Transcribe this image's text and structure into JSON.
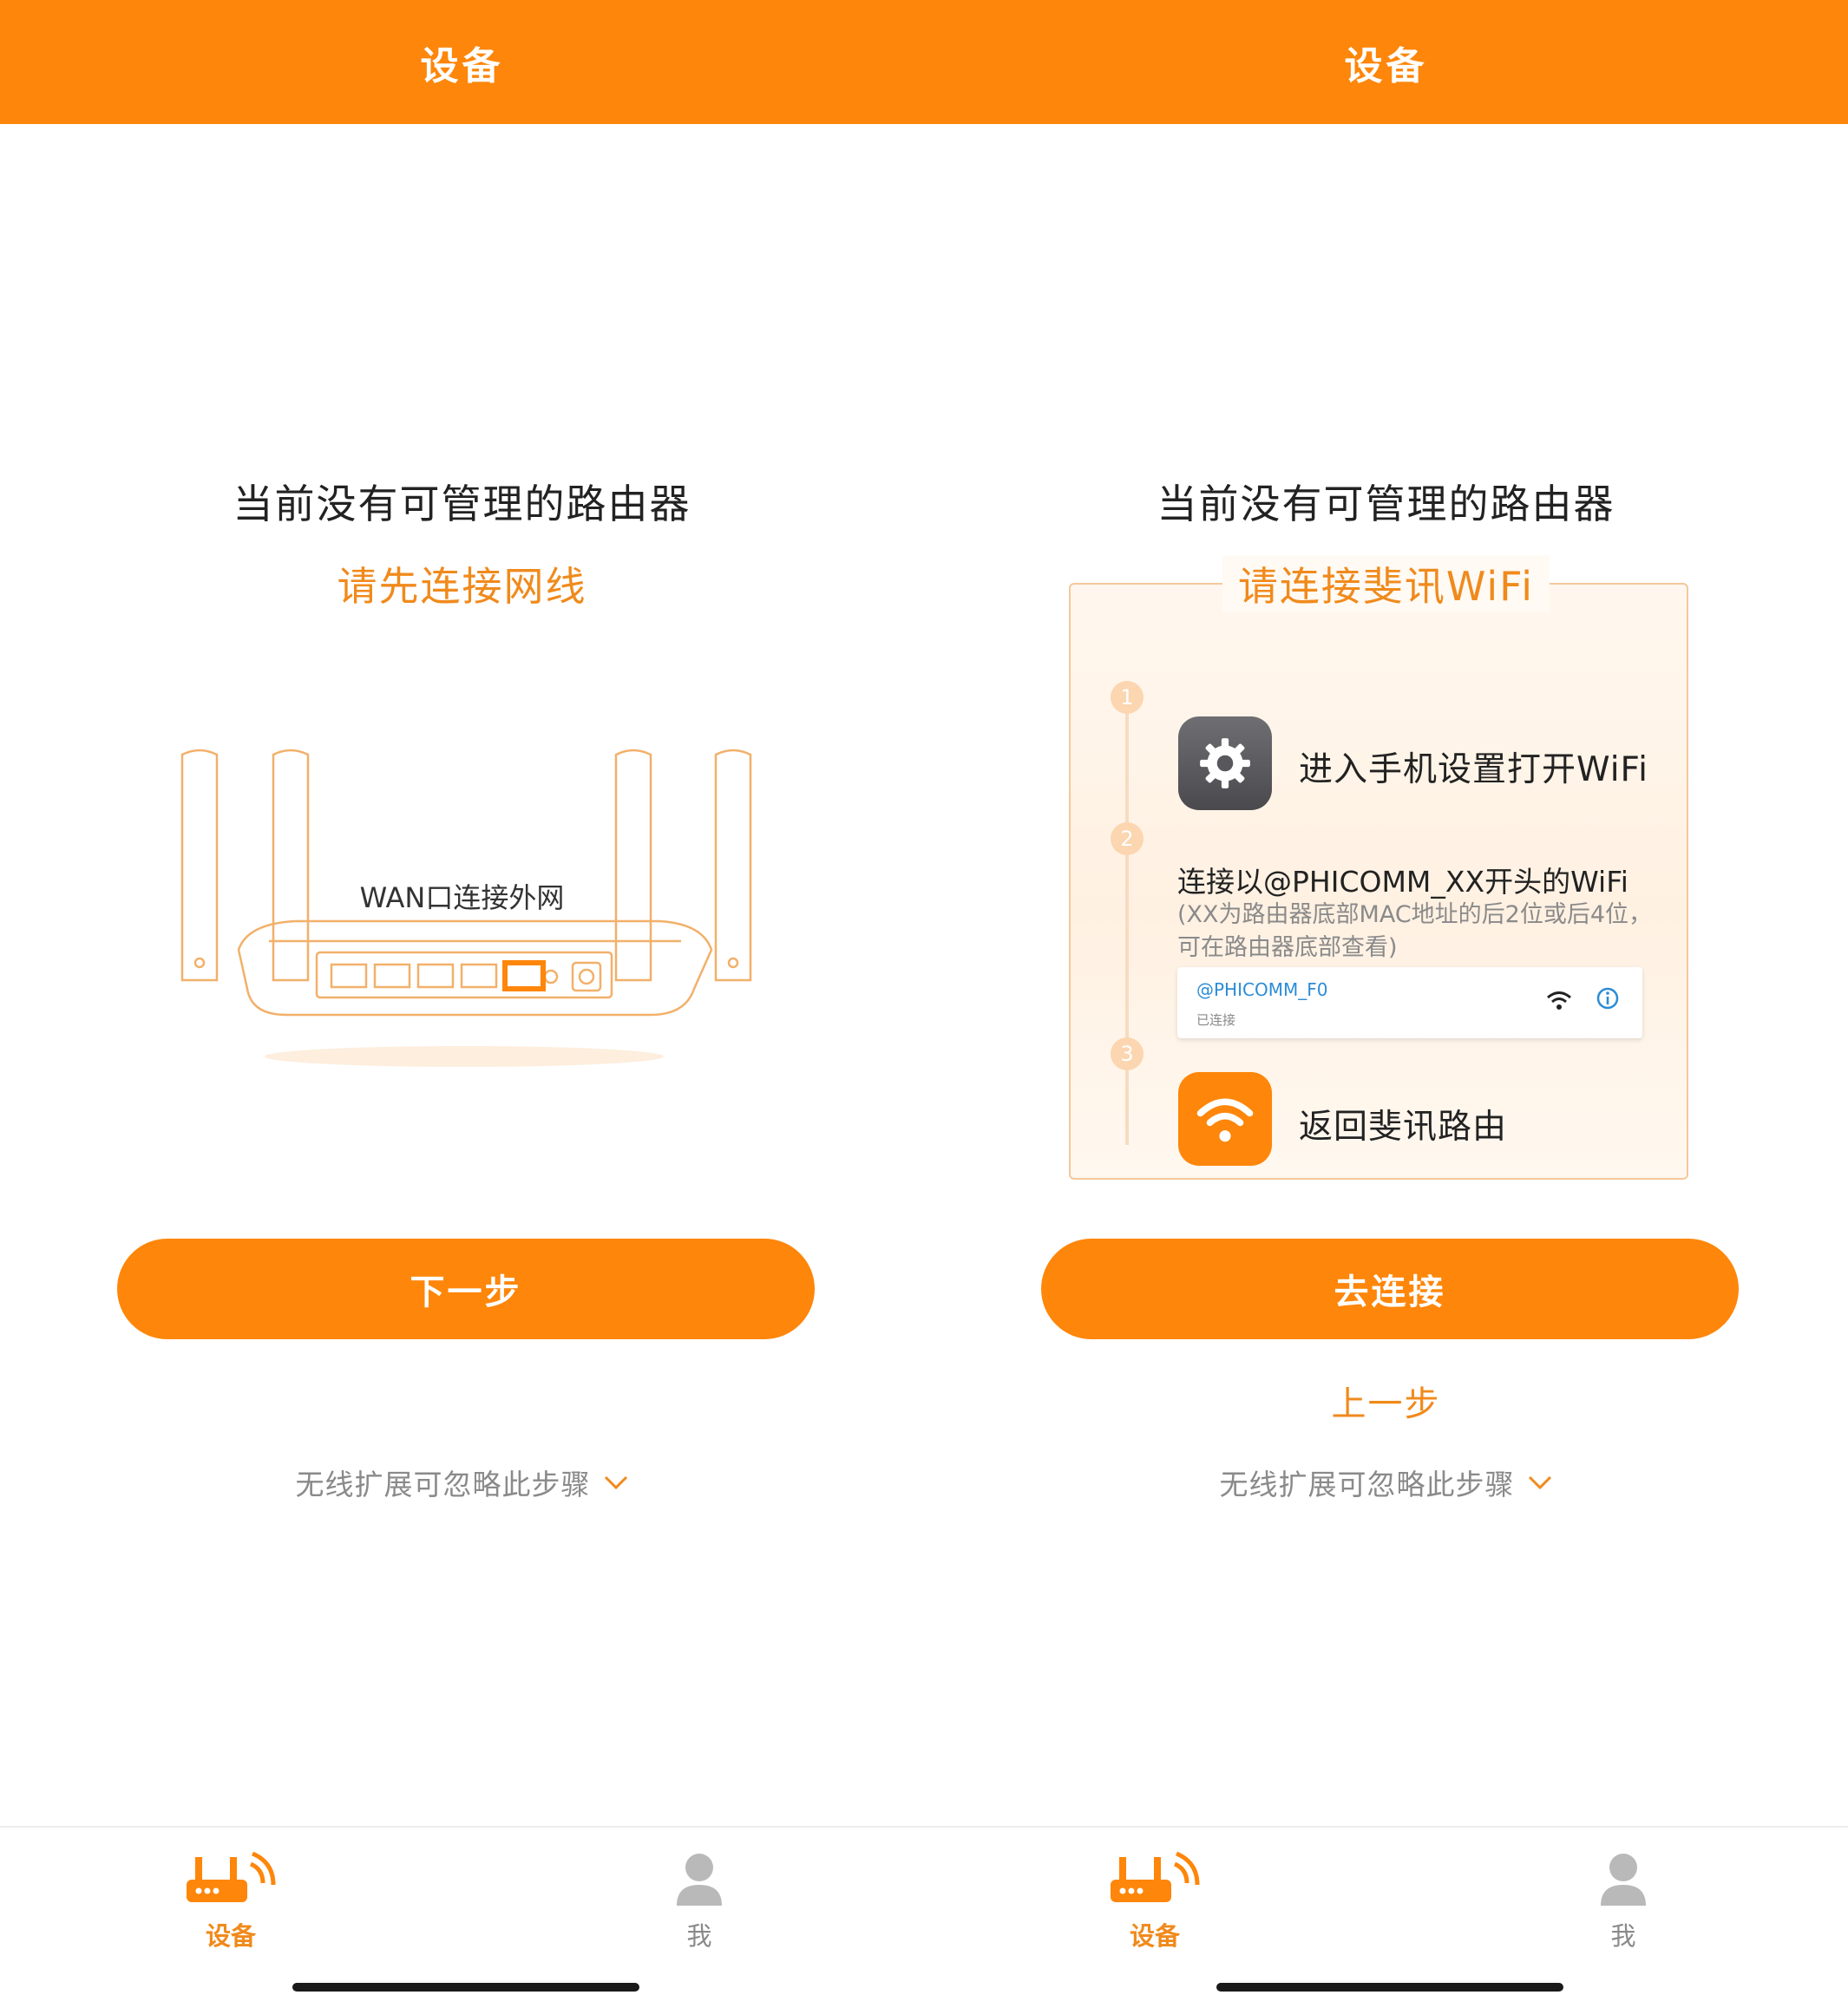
{
  "left": {
    "topbar_title": "设备",
    "heading": "当前没有可管理的路由器",
    "subheading": "请先连接网线",
    "illustration_label": "WAN口连接外网",
    "primary_button": "下一步",
    "skip_text": "无线扩展可忽略此步骤"
  },
  "right": {
    "topbar_title": "设备",
    "heading": "当前没有可管理的路由器",
    "card_title": "请连接斐讯WiFi",
    "steps": [
      {
        "number": "1",
        "text": "进入手机设置打开WiFi",
        "icon": "settings-gear-icon"
      },
      {
        "number": "2",
        "text": "连接以@PHICOMM_XX开头的WiFi",
        "note": "(XX为路由器底部MAC地址的后2位或后4位，可在路由器底部查看)"
      },
      {
        "number": "3",
        "text": "返回斐讯路由",
        "icon": "phicomm-wifi-app-icon"
      }
    ],
    "wifi_example": {
      "ssid": "@PHICOMM_F0",
      "status": "已连接"
    },
    "primary_button": "去连接",
    "back_link": "上一步",
    "skip_text": "无线扩展可忽略此步骤"
  },
  "nav": {
    "items": [
      {
        "label": "设备",
        "icon": "router-icon",
        "active": true
      },
      {
        "label": "我",
        "icon": "user-icon",
        "active": false
      }
    ]
  },
  "colors": {
    "accent": "#fe860a",
    "accent_text": "#f08a1c",
    "muted_text": "#8a8a8a",
    "link_blue": "#2b8cd6"
  }
}
